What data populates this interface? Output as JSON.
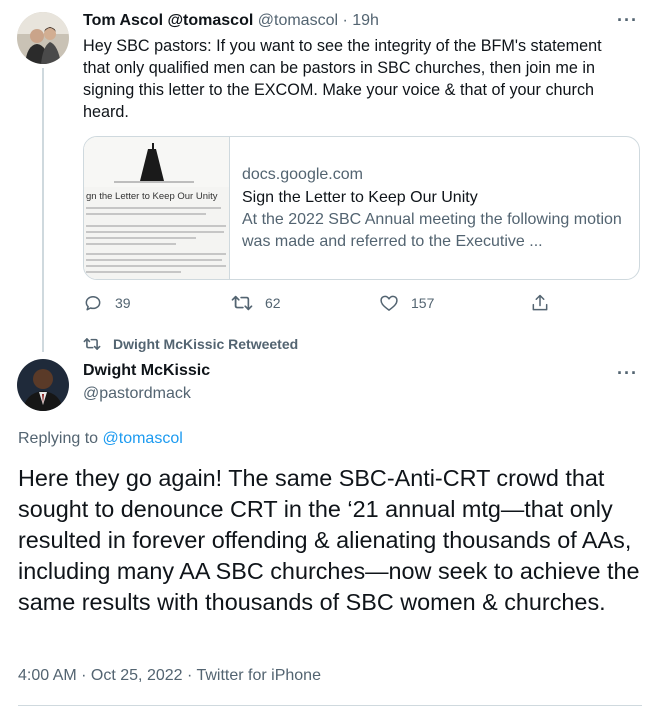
{
  "tweet1": {
    "display_name": "Tom Ascol @tomascol",
    "handle": "@tomascol",
    "separator": "·",
    "time": "19h",
    "text": "Hey SBC pastors: If you want to see the integrity of the BFM's statement that only qualified men can be pastors in SBC churches, then join me in signing this letter to the EXCOM. Make your voice & that of your church heard.",
    "card": {
      "thumbnail_heading": "gn the Letter to Keep Our Unity",
      "domain": "docs.google.com",
      "title": "Sign the Letter to Keep Our Unity",
      "description": "At the 2022 SBC Annual meeting the following motion was made and referred to the Executive ..."
    },
    "actions": {
      "replies": "39",
      "retweets": "62",
      "likes": "157"
    }
  },
  "retweet_label": "Dwight McKissic Retweeted",
  "tweet2": {
    "display_name": "Dwight McKissic",
    "handle": "@pastordmack",
    "replying_prefix": "Replying to",
    "replying_to": "@tomascol",
    "text": "Here they go again! The same SBC-Anti-CRT crowd that sought to denounce CRT in the ‘21 annual mtg—that only resulted in forever offending & alienating thousands of AAs, including many AA SBC churches—now seek to achieve the same results with thousands of SBC women & churches.",
    "meta": "4:00 AM · Oct 25, 2022 · Twitter for iPhone"
  },
  "icons": {
    "more": "more-icon",
    "reply": "reply-icon",
    "retweet": "retweet-icon",
    "like": "heart-icon",
    "share": "share-icon"
  },
  "colors": {
    "text": "#0f1419",
    "muted": "#536471",
    "link": "#1d9bf0",
    "border": "#cfd9de"
  }
}
